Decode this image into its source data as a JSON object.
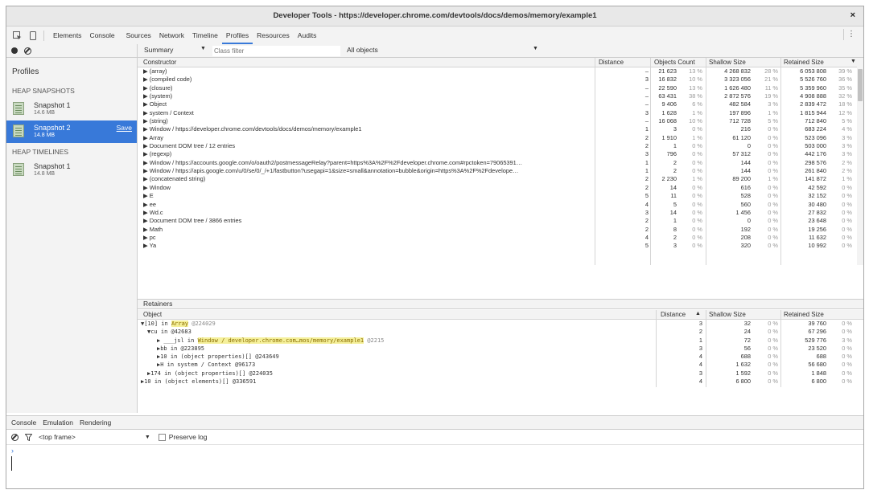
{
  "window": {
    "title": "Developer Tools - https://developer.chrome.com/devtools/docs/demos/memory/example1",
    "close": "×"
  },
  "toolbar": {
    "tabs": [
      "Elements",
      "Console",
      "Sources",
      "Network",
      "Timeline",
      "Profiles",
      "Resources",
      "Audits"
    ],
    "active_tab": "Profiles",
    "menu": "⋮"
  },
  "sidebar": {
    "heading": "Profiles",
    "heap_snapshots": "HEAP SNAPSHOTS",
    "snap1": {
      "name": "Snapshot 1",
      "size": "14.6 MB"
    },
    "snap2": {
      "name": "Snapshot 2",
      "size": "14.8 MB",
      "save": "Save"
    },
    "heap_timelines": "HEAP TIMELINES",
    "snap3": {
      "name": "Snapshot 1",
      "size": "14.8 MB"
    }
  },
  "summary": {
    "view": "Summary",
    "filter_placeholder": "Class filter",
    "objects": "All objects"
  },
  "columns": {
    "constructor": "Constructor",
    "distance": "Distance",
    "objects_count": "Objects Count",
    "shallow": "Shallow Size",
    "retained": "Retained Size"
  },
  "rows": [
    {
      "n": "▶ (array)",
      "d": "–",
      "c": "21 623",
      "cp": "13 %",
      "s": "4 268 832",
      "sp": "28 %",
      "r": "6 053 808",
      "rp": "39 %"
    },
    {
      "n": "▶ (compiled code)",
      "d": "3",
      "c": "16 832",
      "cp": "10 %",
      "s": "3 323 056",
      "sp": "21 %",
      "r": "5 526 760",
      "rp": "36 %"
    },
    {
      "n": "▶ (closure)",
      "d": "–",
      "c": "22 590",
      "cp": "13 %",
      "s": "1 626 480",
      "sp": "11 %",
      "r": "5 359 960",
      "rp": "35 %"
    },
    {
      "n": "▶ (system)",
      "d": "–",
      "c": "63 431",
      "cp": "38 %",
      "s": "2 872 576",
      "sp": "19 %",
      "r": "4 908 888",
      "rp": "32 %"
    },
    {
      "n": "▶ Object",
      "d": "–",
      "c": "9 406",
      "cp": "6 %",
      "s": "482 584",
      "sp": "3 %",
      "r": "2 839 472",
      "rp": "18 %"
    },
    {
      "n": "▶ system / Context",
      "d": "3",
      "c": "1 628",
      "cp": "1 %",
      "s": "197 896",
      "sp": "1 %",
      "r": "1 815 944",
      "rp": "12 %"
    },
    {
      "n": "▶ (string)",
      "d": "–",
      "c": "16 068",
      "cp": "10 %",
      "s": "712 728",
      "sp": "5 %",
      "r": "712 840",
      "rp": "5 %"
    },
    {
      "n": "▶ Window / https://developer.chrome.com/devtools/docs/demos/memory/example1",
      "d": "1",
      "c": "3",
      "cp": "0 %",
      "s": "216",
      "sp": "0 %",
      "r": "683 224",
      "rp": "4 %"
    },
    {
      "n": "▶ Array",
      "d": "2",
      "c": "1 910",
      "cp": "1 %",
      "s": "61 120",
      "sp": "0 %",
      "r": "523 096",
      "rp": "3 %"
    },
    {
      "n": "▶ Document DOM tree / 12 entries",
      "d": "2",
      "c": "1",
      "cp": "0 %",
      "s": "0",
      "sp": "0 %",
      "r": "503 000",
      "rp": "3 %"
    },
    {
      "n": "▶ (regexp)",
      "d": "3",
      "c": "796",
      "cp": "0 %",
      "s": "57 312",
      "sp": "0 %",
      "r": "442 176",
      "rp": "3 %"
    },
    {
      "n": "▶ Window / https://accounts.google.com/o/oauth2/postmessageRelay?parent=https%3A%2F%2Fdeveloper.chrome.com#rpctoken=79065391…",
      "d": "1",
      "c": "2",
      "cp": "0 %",
      "s": "144",
      "sp": "0 %",
      "r": "298 576",
      "rp": "2 %"
    },
    {
      "n": "▶ Window / https://apis.google.com/u/0/se/0/_/+1/fastbutton?usegapi=1&size=small&annotation=bubble&origin=https%3A%2F%2Fdevelope…",
      "d": "1",
      "c": "2",
      "cp": "0 %",
      "s": "144",
      "sp": "0 %",
      "r": "261 840",
      "rp": "2 %"
    },
    {
      "n": "▶ (concatenated string)",
      "d": "2",
      "c": "2 230",
      "cp": "1 %",
      "s": "89 200",
      "sp": "1 %",
      "r": "141 872",
      "rp": "1 %"
    },
    {
      "n": "▶ Window",
      "d": "2",
      "c": "14",
      "cp": "0 %",
      "s": "616",
      "sp": "0 %",
      "r": "42 592",
      "rp": "0 %"
    },
    {
      "n": "▶ E",
      "d": "5",
      "c": "11",
      "cp": "0 %",
      "s": "528",
      "sp": "0 %",
      "r": "32 152",
      "rp": "0 %"
    },
    {
      "n": "▶ ee",
      "d": "4",
      "c": "5",
      "cp": "0 %",
      "s": "560",
      "sp": "0 %",
      "r": "30 480",
      "rp": "0 %"
    },
    {
      "n": "▶ Wd.c",
      "d": "3",
      "c": "14",
      "cp": "0 %",
      "s": "1 456",
      "sp": "0 %",
      "r": "27 832",
      "rp": "0 %"
    },
    {
      "n": "▶ Document DOM tree / 3866 entries",
      "d": "2",
      "c": "1",
      "cp": "0 %",
      "s": "0",
      "sp": "0 %",
      "r": "23 648",
      "rp": "0 %"
    },
    {
      "n": "▶ Math",
      "d": "2",
      "c": "8",
      "cp": "0 %",
      "s": "192",
      "sp": "0 %",
      "r": "19 256",
      "rp": "0 %"
    },
    {
      "n": "▶ pc",
      "d": "4",
      "c": "2",
      "cp": "0 %",
      "s": "208",
      "sp": "0 %",
      "r": "11 632",
      "rp": "0 %"
    },
    {
      "n": "▶ Ya",
      "d": "5",
      "c": "3",
      "cp": "0 %",
      "s": "320",
      "sp": "0 %",
      "r": "10 992",
      "rp": "0 %"
    }
  ],
  "retainers": {
    "title": "Retainers",
    "columns": {
      "object": "Object",
      "distance": "Distance",
      "shallow": "Shallow Size",
      "retained": "Retained Size"
    },
    "rows": [
      {
        "pre": "▼[10] in ",
        "hl": "Array",
        "post": " @224029",
        "d": "3",
        "s": "32",
        "sp": "0 %",
        "r": "39 760",
        "rp": "0 %"
      },
      {
        "pre": "▼cu in @42683",
        "hl": "",
        "post": "",
        "d": "2",
        "s": "24",
        "sp": "0 %",
        "r": "67 296",
        "rp": "0 %"
      },
      {
        "pre": "▶ ___jsl in ",
        "hl": "Window / developer.chrome.com…mos/memory/example1",
        "post": " @2215",
        "d": "1",
        "s": "72",
        "sp": "0 %",
        "r": "529 776",
        "rp": "3 %"
      },
      {
        "pre": "▶bb in @223895",
        "hl": "",
        "post": "",
        "d": "3",
        "s": "56",
        "sp": "0 %",
        "r": "23 520",
        "rp": "0 %"
      },
      {
        "pre": "▶10 in (object properties)[] @243649",
        "hl": "",
        "post": "",
        "d": "4",
        "s": "688",
        "sp": "0 %",
        "r": "688",
        "rp": "0 %"
      },
      {
        "pre": "▶H in system / Context @96173",
        "hl": "",
        "post": "",
        "d": "4",
        "s": "1 632",
        "sp": "0 %",
        "r": "56 680",
        "rp": "0 %"
      },
      {
        "pre": "▶174 in (object properties)[] @224035",
        "hl": "",
        "post": "",
        "d": "3",
        "s": "1 592",
        "sp": "0 %",
        "r": "1 848",
        "rp": "0 %"
      },
      {
        "pre": "▶10 in (object elements)[] @336591",
        "hl": "",
        "post": "",
        "d": "4",
        "s": "6 800",
        "sp": "0 %",
        "r": "6 800",
        "rp": "0 %"
      }
    ]
  },
  "drawer": {
    "tabs": [
      "Console",
      "Emulation",
      "Rendering"
    ],
    "frame": "<top frame>",
    "preserve": "Preserve log",
    "prompt": "›"
  }
}
